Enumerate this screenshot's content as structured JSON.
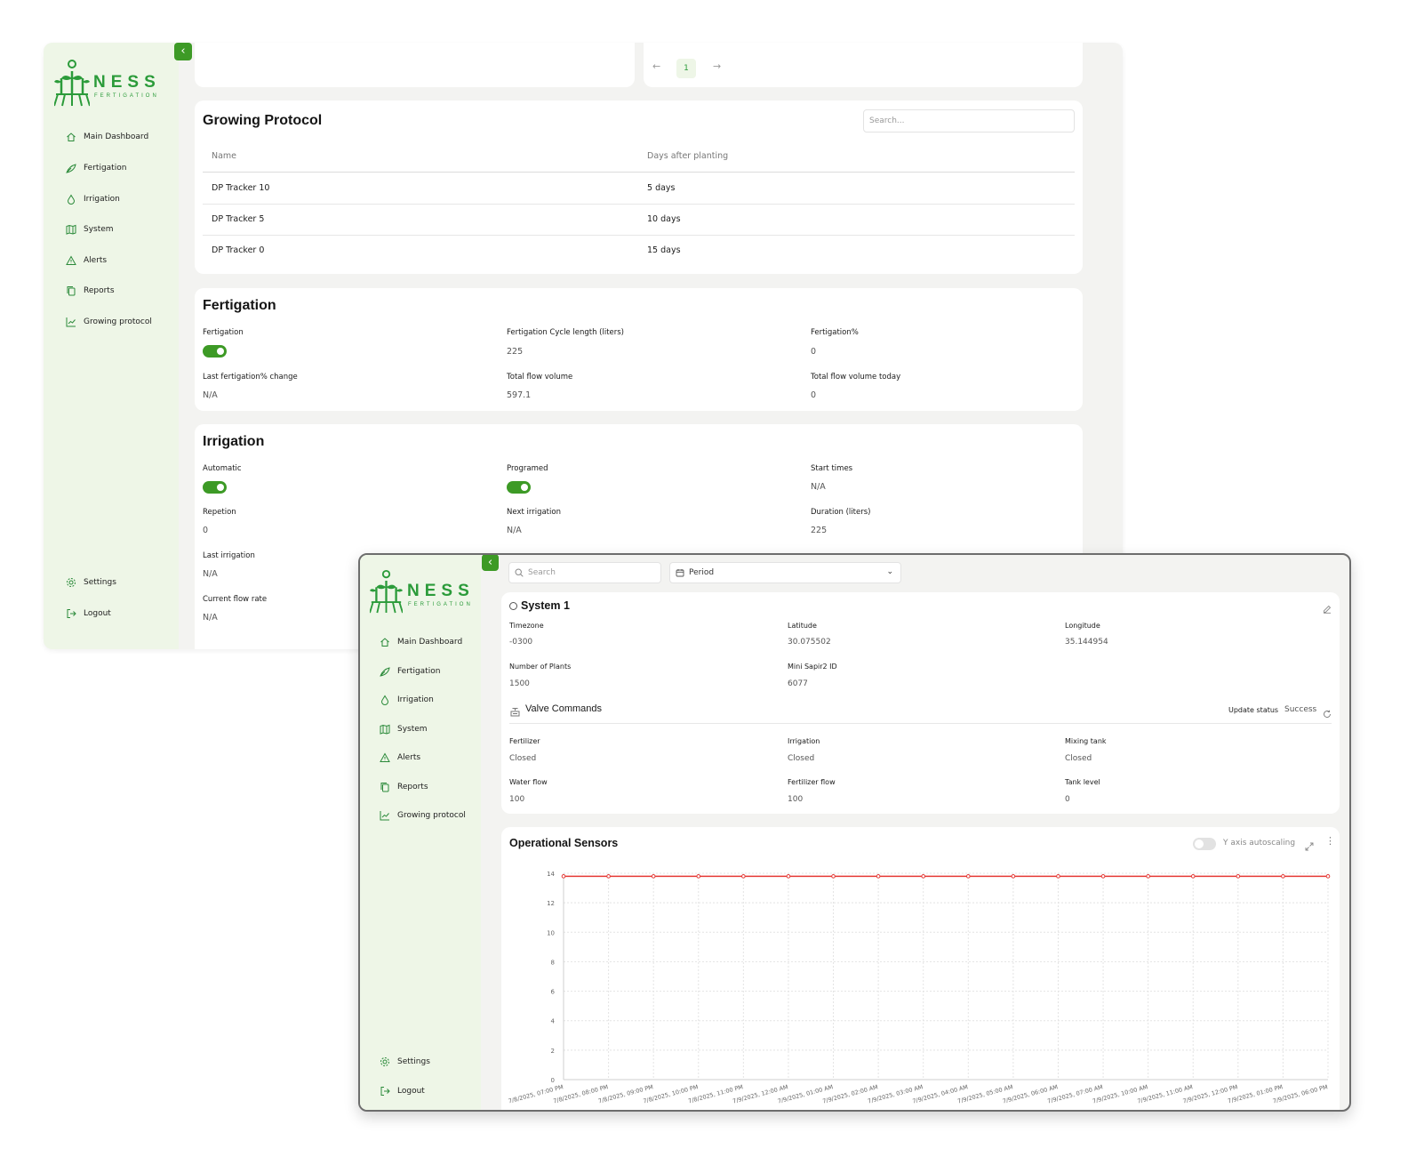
{
  "brand": {
    "name": "NESS",
    "tagline": "FERTIGATION"
  },
  "nav": {
    "items": [
      {
        "label": "Main Dashboard",
        "icon": "home-icon"
      },
      {
        "label": "Fertigation",
        "icon": "leaf-icon"
      },
      {
        "label": "Irrigation",
        "icon": "droplet-icon"
      },
      {
        "label": "System",
        "icon": "map-icon"
      },
      {
        "label": "Alerts",
        "icon": "alert-triangle-icon"
      },
      {
        "label": "Reports",
        "icon": "copy-icon"
      },
      {
        "label": "Growing protocol",
        "icon": "chart-line-icon"
      }
    ],
    "settings": "Settings",
    "logout": "Logout"
  },
  "pagination": {
    "current": "1"
  },
  "growing_protocol": {
    "title": "Growing Protocol",
    "search_placeholder": "Search...",
    "columns": [
      "Name",
      "Days after planting"
    ],
    "rows": [
      [
        "DP Tracker 10",
        "5 days"
      ],
      [
        "DP Tracker 5",
        "10 days"
      ],
      [
        "DP Tracker 0",
        "15 days"
      ]
    ]
  },
  "fertigation": {
    "title": "Fertigation",
    "toggle_label": "Fertigation",
    "toggle_on": true,
    "cycle_label": "Fertigation Cycle length (liters)",
    "cycle_value": "225",
    "percent_label": "Fertigation%",
    "percent_value": "0",
    "last_change_label": "Last fertigation% change",
    "last_change_value": "N/A",
    "total_flow_label": "Total flow volume",
    "total_flow_value": "597.1",
    "total_today_label": "Total flow volume today",
    "total_today_value": "0"
  },
  "irrigation": {
    "title": "Irrigation",
    "automatic_label": "Automatic",
    "automatic_on": true,
    "programed_label": "Programed",
    "programed_on": true,
    "start_times_label": "Start times",
    "start_times_value": "N/A",
    "repetion_label": "Repetion",
    "repetion_value": "0",
    "next_label": "Next irrigation",
    "next_value": "N/A",
    "duration_label": "Duration (liters)",
    "duration_value": "225",
    "last_label": "Last irrigation",
    "last_value": "N/A",
    "flow_rate_label": "Current flow rate",
    "flow_rate_value": "N/A"
  },
  "toolbar": {
    "search_placeholder": "Search",
    "period_label": "Period"
  },
  "system": {
    "title": "System 1",
    "timezone_label": "Timezone",
    "timezone_value": "-0300",
    "latitude_label": "Latitude",
    "latitude_value": "30.075502",
    "longitude_label": "Longitude",
    "longitude_value": "35.144954",
    "plants_label": "Number of Plants",
    "plants_value": "1500",
    "sapir_label": "Mini Sapir2 ID",
    "sapir_value": "6077"
  },
  "valves": {
    "title": "Valve Commands",
    "update_label": "Update status",
    "update_value": "Success",
    "fertilizer_label": "Fertilizer",
    "fertilizer_value": "Closed",
    "irrigation_label": "Irrigation",
    "irrigation_value": "Closed",
    "mixing_label": "Mixing tank",
    "mixing_value": "Closed",
    "water_flow_label": "Water flow",
    "water_flow_value": "100",
    "fert_flow_label": "Fertilizer flow",
    "fert_flow_value": "100",
    "tank_label": "Tank level",
    "tank_value": "0"
  },
  "sensors": {
    "title": "Operational Sensors",
    "autoscale_label": "Y axis autoscaling",
    "autoscale_on": false
  },
  "colors": {
    "accent": "#3d9a26",
    "brand": "#2b9b3a",
    "series": "#e53935",
    "sidebar": "#eef6e7"
  },
  "chart_data": {
    "type": "line",
    "x": [
      "7/8/2025, 07:00 PM",
      "7/8/2025, 08:00 PM",
      "7/8/2025, 09:00 PM",
      "7/8/2025, 10:00 PM",
      "7/8/2025, 11:00 PM",
      "7/9/2025, 12:00 AM",
      "7/9/2025, 01:00 AM",
      "7/9/2025, 02:00 AM",
      "7/9/2025, 03:00 AM",
      "7/9/2025, 04:00 AM",
      "7/9/2025, 05:00 AM",
      "7/9/2025, 06:00 AM",
      "7/9/2025, 07:00 AM",
      "7/9/2025, 10:00 AM",
      "7/9/2025, 11:00 AM",
      "7/9/2025, 12:00 PM",
      "7/9/2025, 01:00 PM",
      "7/9/2025, 06:00 PM"
    ],
    "series": [
      {
        "values": [
          13.8,
          13.8,
          13.8,
          13.8,
          13.8,
          13.8,
          13.8,
          13.8,
          13.8,
          13.8,
          13.8,
          13.8,
          13.8,
          13.8,
          13.8,
          13.8,
          13.8,
          13.8
        ]
      }
    ],
    "yticks": [
      0,
      2,
      4,
      6,
      8,
      10,
      12,
      14
    ],
    "ylim": [
      0,
      14
    ],
    "grid": true
  }
}
